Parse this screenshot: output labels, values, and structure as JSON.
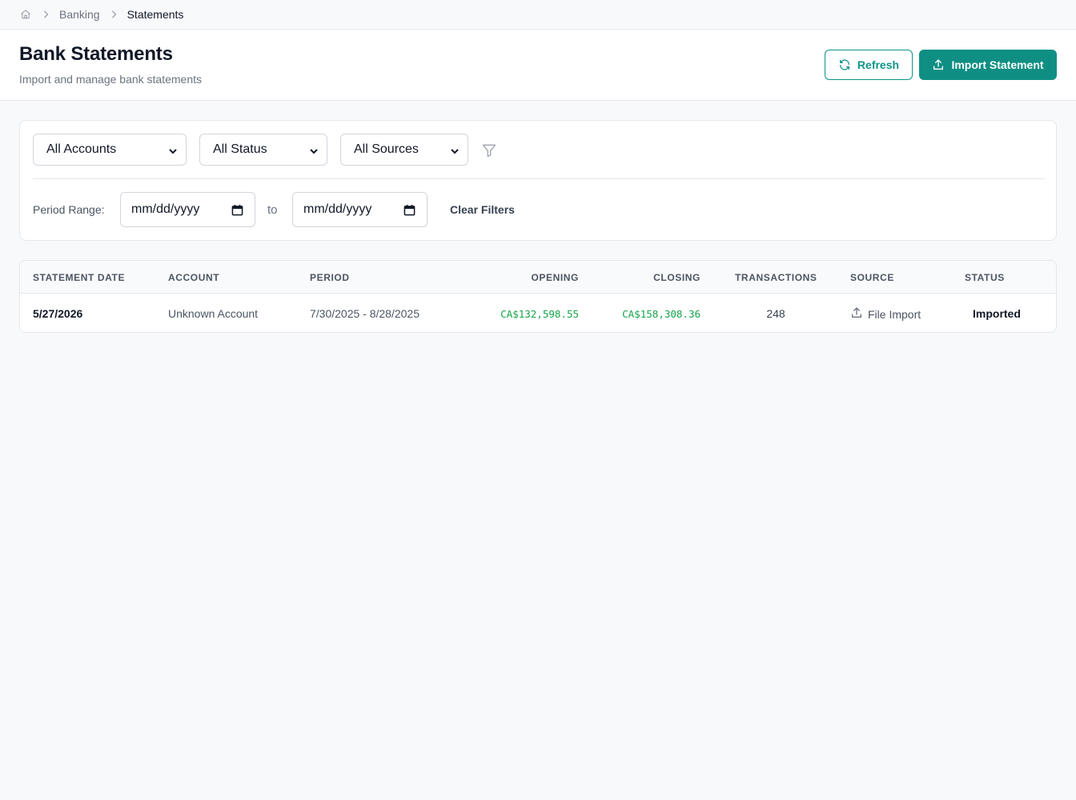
{
  "breadcrumb": {
    "items": [
      "Banking",
      "Statements"
    ]
  },
  "header": {
    "title": "Bank Statements",
    "subtitle": "Import and manage bank statements",
    "refresh_label": "Refresh",
    "import_label": "Import Statement"
  },
  "filters": {
    "accounts": "All Accounts",
    "status": "All Status",
    "sources": "All Sources",
    "period_label": "Period Range:",
    "date_from": "mm/dd/yyyy",
    "to_label": "to",
    "date_to": "mm/dd/yyyy",
    "clear_label": "Clear Filters"
  },
  "table": {
    "columns": [
      "Statement Date",
      "Account",
      "Period",
      "Opening",
      "Closing",
      "Transactions",
      "Source",
      "Status"
    ],
    "rows": [
      {
        "statement_date": "5/27/2026",
        "account": "Unknown Account",
        "period": "7/30/2025 - 8/28/2025",
        "opening": "CA$132,598.55",
        "closing": "CA$158,308.36",
        "transactions": "248",
        "source": "File Import",
        "status": "Imported"
      }
    ]
  },
  "colors": {
    "accent": "#0f8f84",
    "money": "#16a34a"
  }
}
